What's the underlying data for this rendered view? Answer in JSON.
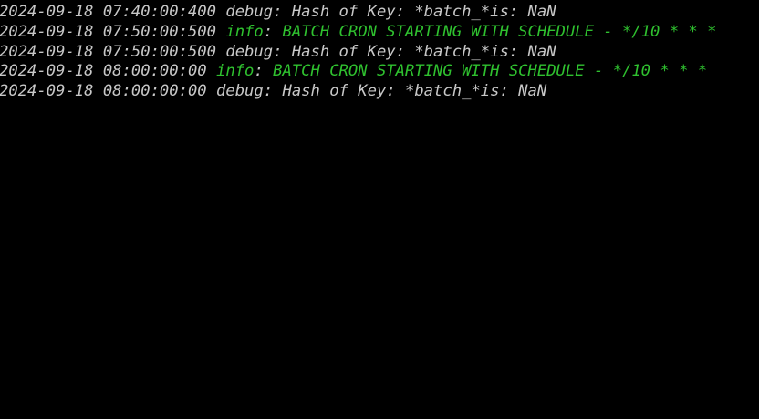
{
  "terminal": {
    "colors": {
      "background": "#000000",
      "debug_text": "#c8c8c8",
      "info_text": "#2fc12f"
    },
    "lines": [
      {
        "timestamp": "2024-09-18 07:40:00:400",
        "level": "debug",
        "message": "Hash of Key: *batch_*is: NaN"
      },
      {
        "timestamp": "2024-09-18 07:50:00:500",
        "level": "info",
        "message": "BATCH CRON STARTING WITH SCHEDULE - */10 * * *"
      },
      {
        "timestamp": "2024-09-18 07:50:00:500",
        "level": "debug",
        "message": "Hash of Key: *batch_*is: NaN"
      },
      {
        "timestamp": "2024-09-18 08:00:00:00",
        "level": "info",
        "message": "BATCH CRON STARTING WITH SCHEDULE - */10 * * *"
      },
      {
        "timestamp": "2024-09-18 08:00:00:00",
        "level": "debug",
        "message": "Hash of Key: *batch_*is: NaN"
      }
    ]
  }
}
